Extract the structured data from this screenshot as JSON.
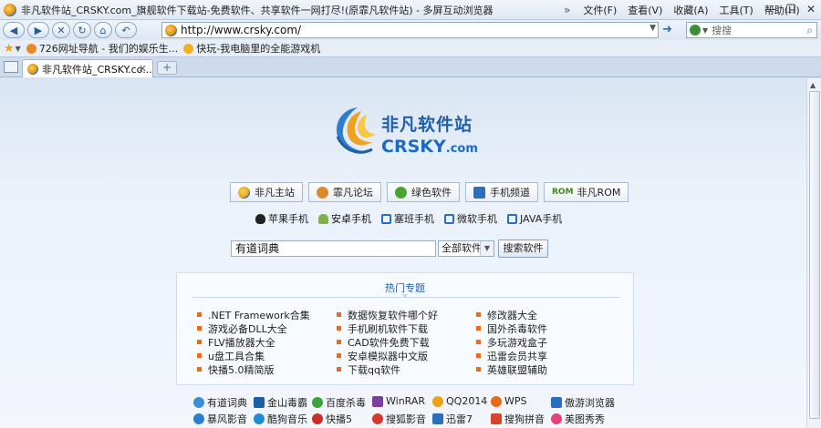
{
  "window": {
    "title": "非凡软件站_CRSKY.com_旗舰软件下载站-免费软件、共享软件一网打尽!(原霏凡软件站) - 多屏互动浏览器",
    "menu": [
      "文件(F)",
      "查看(V)",
      "收藏(A)",
      "工具(T)",
      "帮助(H)"
    ],
    "menu_chevron": "»"
  },
  "nav": {
    "back_label": "◀",
    "forward_label": "▶",
    "stop_label": "✕",
    "refresh_label": "↻",
    "home_label": "⌂",
    "undo_label": "↶",
    "url": "http://www.crsky.com/",
    "go_label": "➜",
    "search_placeholder": "搜搜"
  },
  "favorites": [
    {
      "label": "726网址导航 - 我们的娱乐生...",
      "color": "#e8882a"
    },
    {
      "label": "快玩-我电脑里的全能游戏机",
      "color": "#f0b020"
    }
  ],
  "tabs": [
    {
      "label": "非凡软件站_CRSKY.co...",
      "close": "✕"
    }
  ],
  "new_tab_label": "+",
  "logo": {
    "name_cn": "非凡软件站",
    "name_en": "CRSKY",
    "name_en_suffix": ".com"
  },
  "channels": [
    {
      "label": "非凡主站",
      "color": "#e8a317"
    },
    {
      "label": "霏凡论坛",
      "color": "#d98a2b"
    },
    {
      "label": "绿色软件",
      "color": "#4aa32c"
    },
    {
      "label": "手机频道",
      "color": "#2a6fbf"
    },
    {
      "label": "非凡ROM",
      "prefix": "ROM",
      "color": "#3c8a1c"
    }
  ],
  "phones": [
    {
      "label": "苹果手机",
      "color": "#222222"
    },
    {
      "label": "安卓手机",
      "color": "#7cb342"
    },
    {
      "label": "塞班手机",
      "color": "#2b6cc0"
    },
    {
      "label": "微软手机",
      "color": "#2b6cc0"
    },
    {
      "label": "JAVA手机",
      "color": "#2b6cc0"
    }
  ],
  "search": {
    "value": "有道词典",
    "category": "全部软件",
    "button": "搜索软件"
  },
  "hot_topics": {
    "title": "热门专题",
    "columns": [
      [
        ".NET Framework合集",
        "游戏必备DLL大全",
        "FLV播放器大全",
        "u盘工具合集",
        "快播5.0精简版"
      ],
      [
        "数据恢复软件哪个好",
        "手机刷机软件下载",
        "CAD软件免费下载",
        "安卓模拟器中文版",
        "下载qq软件"
      ],
      [
        "修改器大全",
        "国外杀毒软件",
        "多玩游戏盒子",
        "迅雷会员共享",
        "英雄联盟辅助"
      ]
    ]
  },
  "software": [
    [
      {
        "label": "有道词典",
        "color": "#3b8fd6"
      },
      {
        "label": "金山毒霸",
        "color": "#1c5fa8"
      },
      {
        "label": "百度杀毒",
        "color": "#3aa53a"
      },
      {
        "label": "WinRAR",
        "color": "#7b3fa0"
      },
      {
        "label": "QQ2014",
        "color": "#e8a317"
      },
      {
        "label": "WPS",
        "color": "#e86a1a"
      },
      {
        "label": "傲游浏览器",
        "color": "#2a6fbf"
      }
    ],
    [
      {
        "label": "暴风影音",
        "color": "#2a7fd0"
      },
      {
        "label": "酷狗音乐",
        "color": "#1f8ad8"
      },
      {
        "label": "快播5",
        "color": "#c9302c"
      },
      {
        "label": "搜狐影音",
        "color": "#d73a2a"
      },
      {
        "label": "迅雷7",
        "color": "#2a6fbf"
      },
      {
        "label": "搜狗拼音",
        "color": "#d9452b"
      },
      {
        "label": "美图秀秀",
        "color": "#e8407a"
      }
    ]
  ],
  "window_buttons": [
    "—",
    "❐",
    "✕"
  ]
}
